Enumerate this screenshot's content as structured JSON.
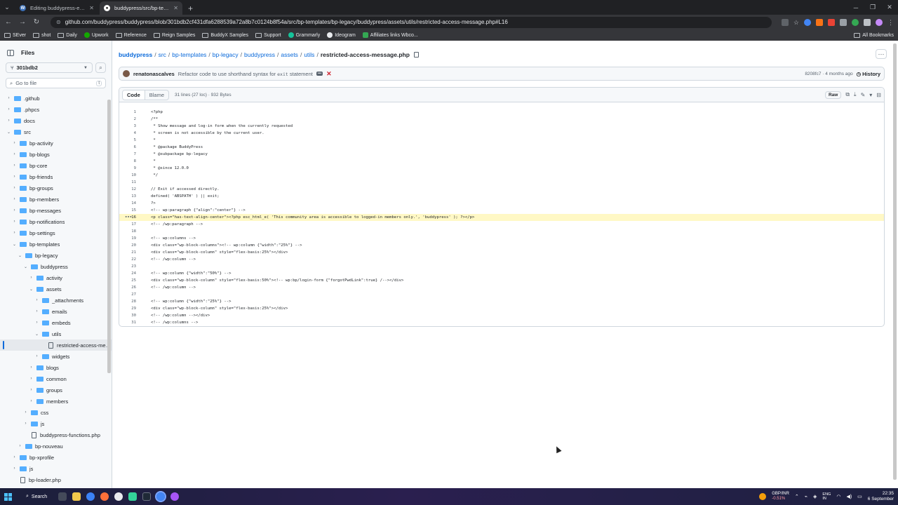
{
  "browser": {
    "tabs": [
      {
        "title": "Editing buddypress-en_US.po",
        "active": false
      },
      {
        "title": "buddypress/src/bp-templates/",
        "active": true
      }
    ],
    "url": "github.com/buddypress/buddypress/blob/301bdb2cf431dfa6288539a72a8b7c0124b8f54a/src/bp-templates/bp-legacy/buddypress/assets/utils/restricted-access-message.php#L16",
    "bookmarks": [
      "SEver",
      "shot",
      "Daily",
      "Upwork",
      "Reference",
      "Reign Samples",
      "BuddyX Samples",
      "Support",
      "Grammarly",
      "Ideogram",
      "Affiliates links Wbco..."
    ],
    "all_bookmarks": "All Bookmarks"
  },
  "sidebar": {
    "title": "Files",
    "branch": "301bdb2",
    "goto_placeholder": "Go to file",
    "goto_kbd": "t",
    "tree": [
      {
        "label": ".github",
        "type": "folder",
        "depth": 0,
        "open": false
      },
      {
        "label": ".phpcs",
        "type": "folder",
        "depth": 0,
        "open": false
      },
      {
        "label": "docs",
        "type": "folder",
        "depth": 0,
        "open": false
      },
      {
        "label": "src",
        "type": "folder",
        "depth": 0,
        "open": true
      },
      {
        "label": "bp-activity",
        "type": "folder",
        "depth": 1,
        "open": false
      },
      {
        "label": "bp-blogs",
        "type": "folder",
        "depth": 1,
        "open": false
      },
      {
        "label": "bp-core",
        "type": "folder",
        "depth": 1,
        "open": false
      },
      {
        "label": "bp-friends",
        "type": "folder",
        "depth": 1,
        "open": false
      },
      {
        "label": "bp-groups",
        "type": "folder",
        "depth": 1,
        "open": false
      },
      {
        "label": "bp-members",
        "type": "folder",
        "depth": 1,
        "open": false
      },
      {
        "label": "bp-messages",
        "type": "folder",
        "depth": 1,
        "open": false
      },
      {
        "label": "bp-notifications",
        "type": "folder",
        "depth": 1,
        "open": false
      },
      {
        "label": "bp-settings",
        "type": "folder",
        "depth": 1,
        "open": false
      },
      {
        "label": "bp-templates",
        "type": "folder",
        "depth": 1,
        "open": true
      },
      {
        "label": "bp-legacy",
        "type": "folder",
        "depth": 2,
        "open": true
      },
      {
        "label": "buddypress",
        "type": "folder",
        "depth": 3,
        "open": true
      },
      {
        "label": "activity",
        "type": "folder",
        "depth": 4,
        "open": false
      },
      {
        "label": "assets",
        "type": "folder",
        "depth": 4,
        "open": true
      },
      {
        "label": "_attachments",
        "type": "folder",
        "depth": 5,
        "open": false
      },
      {
        "label": "emails",
        "type": "folder",
        "depth": 5,
        "open": false
      },
      {
        "label": "embeds",
        "type": "folder",
        "depth": 5,
        "open": false
      },
      {
        "label": "utils",
        "type": "folder",
        "depth": 5,
        "open": true
      },
      {
        "label": "restricted-access-messag...",
        "type": "file",
        "depth": 6,
        "selected": true
      },
      {
        "label": "widgets",
        "type": "folder",
        "depth": 5,
        "open": false
      },
      {
        "label": "blogs",
        "type": "folder",
        "depth": 4,
        "open": false
      },
      {
        "label": "common",
        "type": "folder",
        "depth": 4,
        "open": false
      },
      {
        "label": "groups",
        "type": "folder",
        "depth": 4,
        "open": false
      },
      {
        "label": "members",
        "type": "folder",
        "depth": 4,
        "open": false
      },
      {
        "label": "css",
        "type": "folder",
        "depth": 3,
        "open": false
      },
      {
        "label": "js",
        "type": "folder",
        "depth": 3,
        "open": false
      },
      {
        "label": "buddypress-functions.php",
        "type": "file",
        "depth": 3
      },
      {
        "label": "bp-nouveau",
        "type": "folder",
        "depth": 2,
        "open": false
      },
      {
        "label": "bp-xprofile",
        "type": "folder",
        "depth": 1,
        "open": false
      },
      {
        "label": "js",
        "type": "folder",
        "depth": 1,
        "open": false
      },
      {
        "label": "bp-loader.php",
        "type": "file",
        "depth": 1
      }
    ]
  },
  "breadcrumb": {
    "parts": [
      "buddypress",
      "src",
      "bp-templates",
      "bp-legacy",
      "buddypress",
      "assets",
      "utils"
    ],
    "current": "restricted-access-message.php"
  },
  "commit": {
    "author": "renatonascalves",
    "message": "Refactor code to use shorthand syntax for",
    "message_code": "exit",
    "message_tail": "statement",
    "hash_time": "8208fc7 · 4 months ago",
    "history": "History"
  },
  "file": {
    "tab_code": "Code",
    "tab_blame": "Blame",
    "info": "31 lines (27 loc) · 932 Bytes",
    "raw": "Raw",
    "highlight_line": 16,
    "lines": [
      "<?php",
      "/**",
      " * Show message and log-in form when the currently requested",
      " * screen is not accessible by the current user.",
      " *",
      " * @package BuddyPress",
      " * @subpackage bp-legacy",
      " *",
      " * @since 12.0.0",
      " */",
      "",
      "// Exit if accessed directly.",
      "defined( 'ABSPATH' ) || exit;",
      "?>",
      "<!-- wp:paragraph {\"align\":\"center\"} -->",
      "<p class=\"has-text-align-center\"><?php esc_html_e( 'This community area is accessible to logged-in members only.', 'buddypress' ); ?></p>",
      "<!-- /wp:paragraph -->",
      "",
      "<!-- wp:columns -->",
      "<div class=\"wp-block-columns\"><!-- wp:column {\"width\":\"25%\"} -->",
      "<div class=\"wp-block-column\" style=\"flex-basis:25%\"></div>",
      "<!-- /wp:column -->",
      "",
      "<!-- wp:column {\"width\":\"50%\"} -->",
      "<div class=\"wp-block-column\" style=\"flex-basis:50%\"><!-- wp:bp/login-form {\"forgotPwdLink\":true} /--></div>",
      "<!-- /wp:column -->",
      "",
      "<!-- wp:column {\"width\":\"25%\"} -->",
      "<div class=\"wp-block-column\" style=\"flex-basis:25%\"></div>",
      "<!-- /wp:column --></div>",
      "<!-- /wp:columns -->"
    ]
  },
  "taskbar": {
    "search": "Search",
    "stock_name": "GBP/INR",
    "stock_change": "-0.51%",
    "lang_top": "ENG",
    "lang_bottom": "IN",
    "time": "22:35",
    "date": "6 September"
  }
}
